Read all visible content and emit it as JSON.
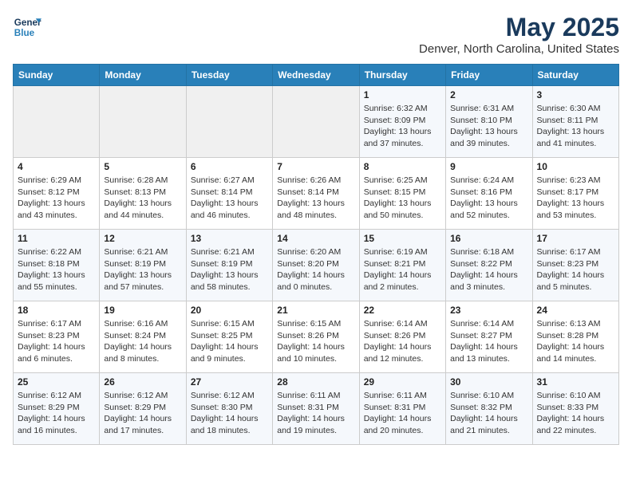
{
  "header": {
    "logo_line1": "General",
    "logo_line2": "Blue",
    "title": "May 2025",
    "subtitle": "Denver, North Carolina, United States"
  },
  "days_of_week": [
    "Sunday",
    "Monday",
    "Tuesday",
    "Wednesday",
    "Thursday",
    "Friday",
    "Saturday"
  ],
  "weeks": [
    [
      {
        "day": "",
        "info": ""
      },
      {
        "day": "",
        "info": ""
      },
      {
        "day": "",
        "info": ""
      },
      {
        "day": "",
        "info": ""
      },
      {
        "day": "1",
        "info": "Sunrise: 6:32 AM\nSunset: 8:09 PM\nDaylight: 13 hours\nand 37 minutes."
      },
      {
        "day": "2",
        "info": "Sunrise: 6:31 AM\nSunset: 8:10 PM\nDaylight: 13 hours\nand 39 minutes."
      },
      {
        "day": "3",
        "info": "Sunrise: 6:30 AM\nSunset: 8:11 PM\nDaylight: 13 hours\nand 41 minutes."
      }
    ],
    [
      {
        "day": "4",
        "info": "Sunrise: 6:29 AM\nSunset: 8:12 PM\nDaylight: 13 hours\nand 43 minutes."
      },
      {
        "day": "5",
        "info": "Sunrise: 6:28 AM\nSunset: 8:13 PM\nDaylight: 13 hours\nand 44 minutes."
      },
      {
        "day": "6",
        "info": "Sunrise: 6:27 AM\nSunset: 8:14 PM\nDaylight: 13 hours\nand 46 minutes."
      },
      {
        "day": "7",
        "info": "Sunrise: 6:26 AM\nSunset: 8:14 PM\nDaylight: 13 hours\nand 48 minutes."
      },
      {
        "day": "8",
        "info": "Sunrise: 6:25 AM\nSunset: 8:15 PM\nDaylight: 13 hours\nand 50 minutes."
      },
      {
        "day": "9",
        "info": "Sunrise: 6:24 AM\nSunset: 8:16 PM\nDaylight: 13 hours\nand 52 minutes."
      },
      {
        "day": "10",
        "info": "Sunrise: 6:23 AM\nSunset: 8:17 PM\nDaylight: 13 hours\nand 53 minutes."
      }
    ],
    [
      {
        "day": "11",
        "info": "Sunrise: 6:22 AM\nSunset: 8:18 PM\nDaylight: 13 hours\nand 55 minutes."
      },
      {
        "day": "12",
        "info": "Sunrise: 6:21 AM\nSunset: 8:19 PM\nDaylight: 13 hours\nand 57 minutes."
      },
      {
        "day": "13",
        "info": "Sunrise: 6:21 AM\nSunset: 8:19 PM\nDaylight: 13 hours\nand 58 minutes."
      },
      {
        "day": "14",
        "info": "Sunrise: 6:20 AM\nSunset: 8:20 PM\nDaylight: 14 hours\nand 0 minutes."
      },
      {
        "day": "15",
        "info": "Sunrise: 6:19 AM\nSunset: 8:21 PM\nDaylight: 14 hours\nand 2 minutes."
      },
      {
        "day": "16",
        "info": "Sunrise: 6:18 AM\nSunset: 8:22 PM\nDaylight: 14 hours\nand 3 minutes."
      },
      {
        "day": "17",
        "info": "Sunrise: 6:17 AM\nSunset: 8:23 PM\nDaylight: 14 hours\nand 5 minutes."
      }
    ],
    [
      {
        "day": "18",
        "info": "Sunrise: 6:17 AM\nSunset: 8:23 PM\nDaylight: 14 hours\nand 6 minutes."
      },
      {
        "day": "19",
        "info": "Sunrise: 6:16 AM\nSunset: 8:24 PM\nDaylight: 14 hours\nand 8 minutes."
      },
      {
        "day": "20",
        "info": "Sunrise: 6:15 AM\nSunset: 8:25 PM\nDaylight: 14 hours\nand 9 minutes."
      },
      {
        "day": "21",
        "info": "Sunrise: 6:15 AM\nSunset: 8:26 PM\nDaylight: 14 hours\nand 10 minutes."
      },
      {
        "day": "22",
        "info": "Sunrise: 6:14 AM\nSunset: 8:26 PM\nDaylight: 14 hours\nand 12 minutes."
      },
      {
        "day": "23",
        "info": "Sunrise: 6:14 AM\nSunset: 8:27 PM\nDaylight: 14 hours\nand 13 minutes."
      },
      {
        "day": "24",
        "info": "Sunrise: 6:13 AM\nSunset: 8:28 PM\nDaylight: 14 hours\nand 14 minutes."
      }
    ],
    [
      {
        "day": "25",
        "info": "Sunrise: 6:12 AM\nSunset: 8:29 PM\nDaylight: 14 hours\nand 16 minutes."
      },
      {
        "day": "26",
        "info": "Sunrise: 6:12 AM\nSunset: 8:29 PM\nDaylight: 14 hours\nand 17 minutes."
      },
      {
        "day": "27",
        "info": "Sunrise: 6:12 AM\nSunset: 8:30 PM\nDaylight: 14 hours\nand 18 minutes."
      },
      {
        "day": "28",
        "info": "Sunrise: 6:11 AM\nSunset: 8:31 PM\nDaylight: 14 hours\nand 19 minutes."
      },
      {
        "day": "29",
        "info": "Sunrise: 6:11 AM\nSunset: 8:31 PM\nDaylight: 14 hours\nand 20 minutes."
      },
      {
        "day": "30",
        "info": "Sunrise: 6:10 AM\nSunset: 8:32 PM\nDaylight: 14 hours\nand 21 minutes."
      },
      {
        "day": "31",
        "info": "Sunrise: 6:10 AM\nSunset: 8:33 PM\nDaylight: 14 hours\nand 22 minutes."
      }
    ]
  ]
}
